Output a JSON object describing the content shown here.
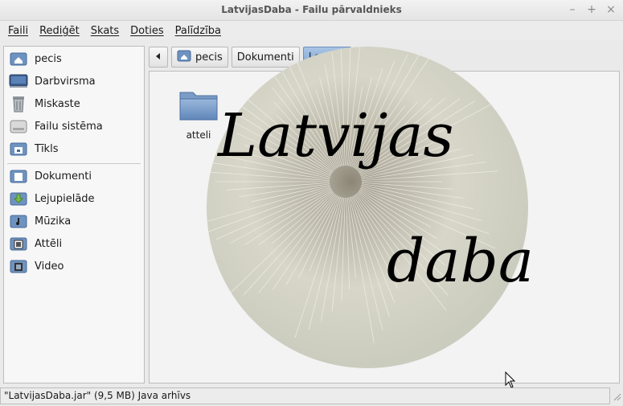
{
  "window": {
    "title": "LatvijasDaba - Failu pārvaldnieks"
  },
  "menu": [
    "Faili",
    "Rediģēt",
    "Skats",
    "Doties",
    "Palīdzība"
  ],
  "sidebar": {
    "places": [
      {
        "label": "pecis",
        "icon": "home-icon"
      },
      {
        "label": "Darbvirsma",
        "icon": "desktop-icon"
      },
      {
        "label": "Miskaste",
        "icon": "trash-icon"
      },
      {
        "label": "Failu sistēma",
        "icon": "drive-icon"
      },
      {
        "label": "Tīkls",
        "icon": "network-icon"
      }
    ],
    "bookmarks": [
      {
        "label": "Dokumenti",
        "icon": "documents-folder-icon"
      },
      {
        "label": "Lejupielāde",
        "icon": "download-folder-icon"
      },
      {
        "label": "Mūzika",
        "icon": "music-folder-icon"
      },
      {
        "label": "Attēli",
        "icon": "pictures-folder-icon"
      },
      {
        "label": "Video",
        "icon": "video-folder-icon"
      }
    ]
  },
  "pathbar": {
    "back_icon": "back-arrow-icon",
    "crumbs": [
      "pecis",
      "Dokumenti",
      "La"
    ]
  },
  "files": [
    {
      "label": "atteli",
      "icon": "folder-icon"
    }
  ],
  "splash": {
    "line1": "Latvijas",
    "line2": "daba"
  },
  "status": {
    "text": "\"LatvijasDaba.jar\" (9,5 MB) Java arhīvs"
  },
  "colors": {
    "accent": "#7ea4d1",
    "folder": "#6f93c0"
  }
}
